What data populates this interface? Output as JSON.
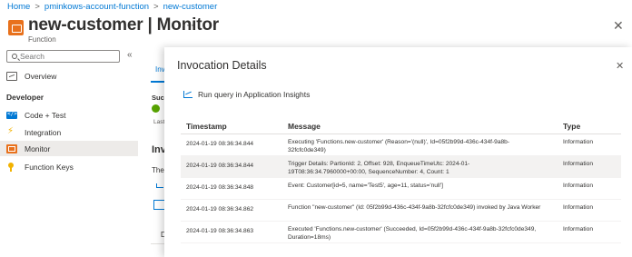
{
  "breadcrumb": {
    "items": [
      "Home",
      "pminkows-account-function",
      "new-customer"
    ],
    "separator": ">"
  },
  "header": {
    "title": "new-customer | Monitor",
    "subtitle": "Function",
    "more": "···",
    "close": "✕"
  },
  "sidebar": {
    "search_placeholder": "Search",
    "collapse": "«",
    "overview": "Overview",
    "section_developer": "Developer",
    "items": [
      {
        "label": "Code + Test",
        "icon": "code-icon"
      },
      {
        "label": "Integration",
        "icon": "lightning-icon"
      },
      {
        "label": "Monitor",
        "icon": "monitor-icon"
      },
      {
        "label": "Function Keys",
        "icon": "key-icon"
      }
    ]
  },
  "background": {
    "tab": "Invo",
    "succ": "Succ",
    "last": "Last",
    "heading": "Invo",
    "text": "The",
    "d": "D"
  },
  "panel": {
    "title": "Invocation Details",
    "close": "✕",
    "ai_link": "Run query in Application Insights",
    "columns": [
      "Timestamp",
      "Message",
      "Type"
    ],
    "rows": [
      {
        "timestamp": "2024-01-19 08:36:34.844",
        "message": "Executing 'Functions.new-customer' (Reason='(null)', Id=05f2b99d-436c-434f-9a8b-32fcfc0de349)",
        "type": "Information"
      },
      {
        "timestamp": "2024-01-19 08:36:34.844",
        "message": "Trigger Details: PartionId: 2, Offset: 928, EnqueueTimeUtc: 2024-01-19T08:36:34.7960000+00:00, SequenceNumber: 4, Count: 1",
        "type": "Information"
      },
      {
        "timestamp": "2024-01-19 08:36:34.848",
        "message": "Event: Customer[id=5, name='Test5', age=11, status='null']",
        "type": "Information"
      },
      {
        "timestamp": "2024-01-19 08:36:34.862",
        "message": "Function \"new-customer\" (Id: 05f2b99d-436c-434f-9a8b-32fcfc0de349) invoked by Java Worker",
        "type": "Information"
      },
      {
        "timestamp": "2024-01-19 08:36:34.863",
        "message": "Executed 'Functions.new-customer' (Succeeded, Id=05f2b99d-436c-434f-9a8b-32fcfc0de349, Duration=18ms)",
        "type": "Information"
      }
    ]
  },
  "colors": {
    "accent": "#0078d4",
    "function_icon": "#e8711c",
    "success": "#57a300",
    "selected_row": "#f3f2f1"
  }
}
